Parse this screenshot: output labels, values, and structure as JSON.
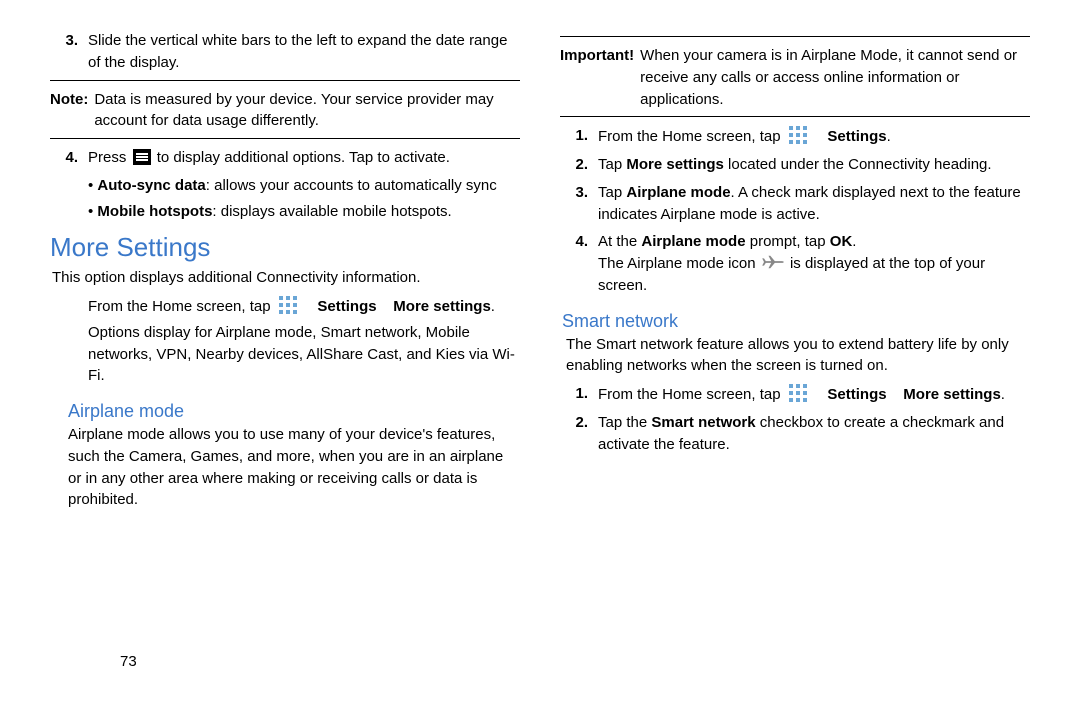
{
  "left": {
    "step3_num": "3.",
    "step3": "Slide the vertical white bars to the left to expand the date range of the display.",
    "note_label": "Note:",
    "note_body": "Data is measured by your device. Your service provider may account for data usage differently.",
    "step4_num": "4.",
    "step4_a": "Press",
    "step4_b": "to display additional options. Tap to activate.",
    "bullet1_label": "Auto-sync data",
    "bullet1_rest": ": allows your accounts to automatically sync",
    "bullet2_label": "Mobile hotspots",
    "bullet2_rest": ": displays available mobile hotspots.",
    "h1": "More Settings",
    "ms_intro": "This option displays additional Connectivity information.",
    "ms_from_a": "From the Home screen, tap",
    "ms_from_b": "Settings",
    "ms_from_c": "More settings",
    "ms_period": ".",
    "ms_options": "Options display for Airplane mode, Smart network, Mobile networks, VPN, Nearby devices, AllShare Cast, and Kies via Wi-Fi.",
    "h2_airplane": "Airplane mode",
    "airplane_para": "Airplane mode allows you to use many of your device's features, such the Camera, Games, and more, when you are in an airplane or in any other area where making or receiving calls or data is prohibited.",
    "pagenum": "73"
  },
  "right": {
    "imp_label": "Important!",
    "imp_body": "When your camera is in Airplane Mode, it cannot send or receive any calls or access online information or applications.",
    "s1_num": "1.",
    "s1_a": "From the Home screen, tap",
    "s1_b": "Settings",
    "s1_period": ".",
    "s2_num": "2.",
    "s2_a": "Tap",
    "s2_b": "More settings",
    "s2_c": "located under the Connectivity heading.",
    "s3_num": "3.",
    "s3_a": "Tap",
    "s3_b": "Airplane mode",
    "s3_c": ". A check mark displayed next to the feature indicates Airplane mode is active.",
    "s4_num": "4.",
    "s4_a": "At the",
    "s4_b": "Airplane mode",
    "s4_c": "prompt, tap",
    "s4_d": "OK",
    "s4_period": ".",
    "s4_line2a": "The Airplane mode icon",
    "s4_line2b": "is displayed at the top of your screen.",
    "h2_smart": "Smart network",
    "sn_para": "The Smart network feature allows you to extend battery life by only enabling networks when the screen is turned on.",
    "sn1_num": "1.",
    "sn1_a": "From the Home screen, tap",
    "sn1_b": "Settings",
    "sn1_c": "More settings",
    "sn1_period": ".",
    "sn2_num": "2.",
    "sn2_a": "Tap the",
    "sn2_b": "Smart network",
    "sn2_c": "checkbox to create a checkmark and activate the feature."
  }
}
